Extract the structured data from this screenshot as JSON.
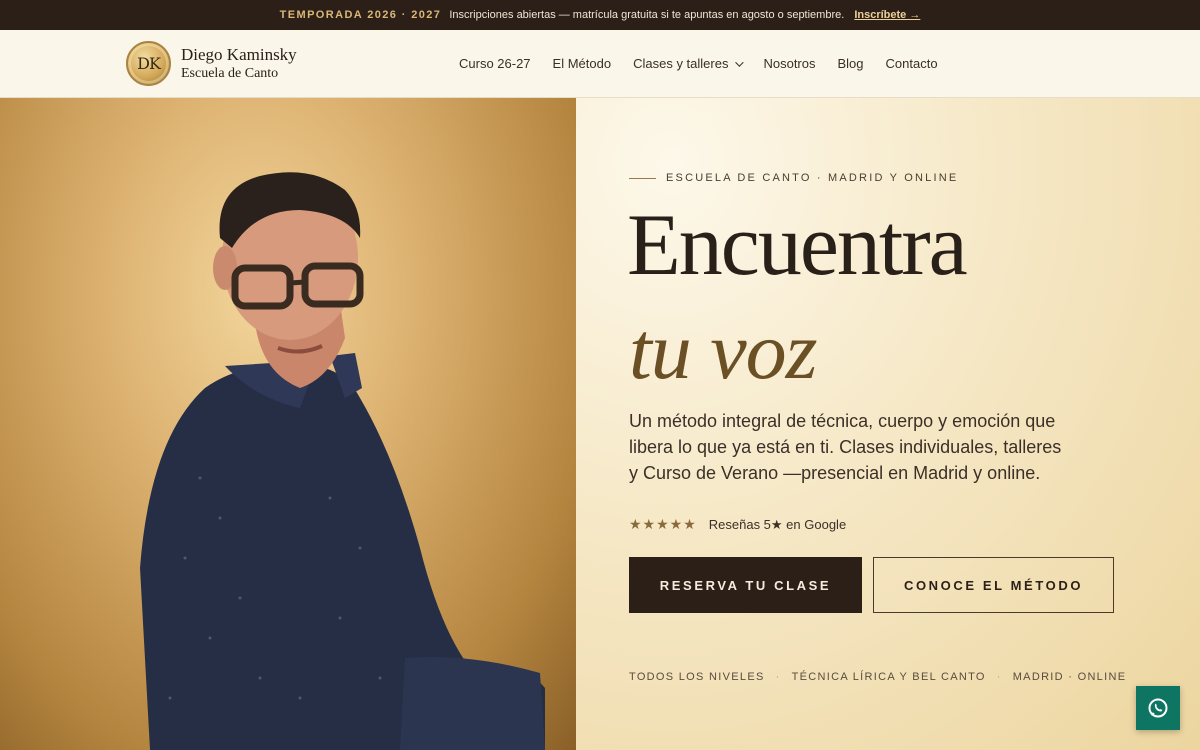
{
  "announcement": {
    "season": "TEMPORADA 2026 · 2027",
    "message": "Inscripciones abiertas — matrícula gratuita si te apuntas en agosto o septiembre.",
    "cta": "Inscríbete →"
  },
  "header": {
    "logo_text": "DK",
    "brand_name": "Diego Kaminsky",
    "brand_sub": "Escuela de Canto",
    "nav": [
      {
        "label": "Curso 26-27"
      },
      {
        "label": "El Método"
      },
      {
        "label": "Clases y talleres",
        "icon": "chevron-down-icon"
      },
      {
        "label": "Nosotros"
      },
      {
        "label": "Blog"
      },
      {
        "label": "Contacto"
      }
    ]
  },
  "hero": {
    "eyebrow": "ESCUELA DE CANTO · MADRID Y ONLINE",
    "title_line1": "Encuentra",
    "title_line2": "tu voz",
    "lead": "Un método integral de técnica, cuerpo y emoción que libera lo que ya está en ti. Clases individuales, talleres y Curso de Verano —presencial en Madrid y online.",
    "stars": "★★★★★",
    "reviews": "Reseñas 5★ en Google",
    "primary_button": "RESERVA TU CLASE",
    "secondary_button": "CONOCE EL MÉTODO",
    "tags": [
      "TODOS LOS NIVELES",
      "TÉCNICA LÍRICA Y BEL CANTO",
      "MADRID · ONLINE"
    ],
    "tag_separator": "·"
  },
  "colors": {
    "dark": "#2b1f17",
    "accent_gold": "#6b4f25",
    "whatsapp": "#0f7563"
  },
  "floating": {
    "whatsapp_icon": "whatsapp-icon"
  }
}
